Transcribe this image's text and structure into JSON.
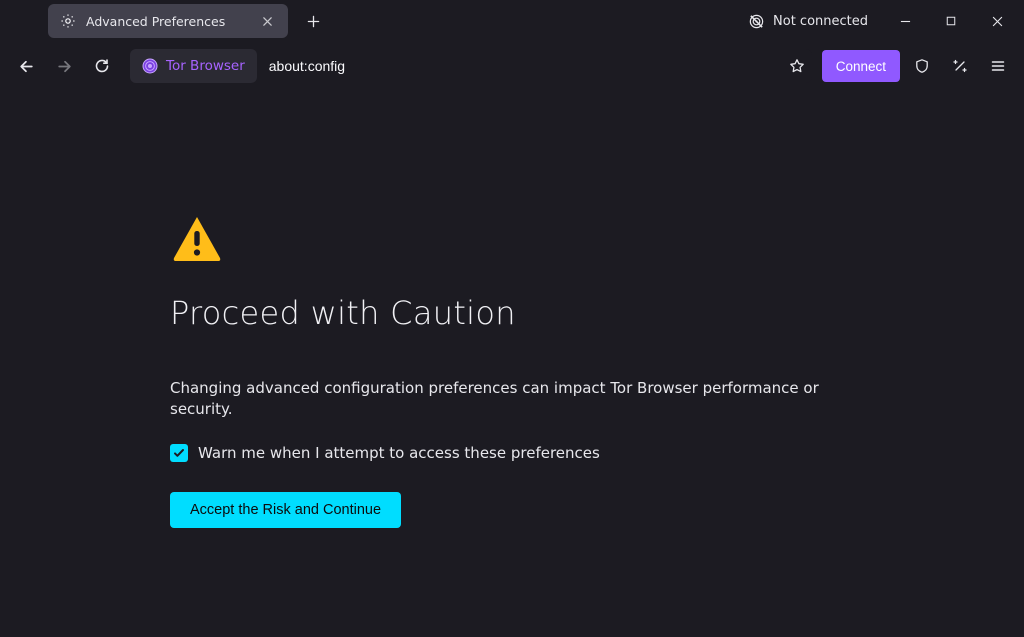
{
  "tab": {
    "title": "Advanced Preferences"
  },
  "connection_status": {
    "label": "Not connected"
  },
  "toolbar": {
    "identity_label": "Tor Browser",
    "url_value": "about:config",
    "connect_label": "Connect"
  },
  "warning": {
    "title": "Proceed with Caution",
    "description": "Changing advanced configuration preferences can impact Tor Browser performance or security.",
    "checkbox_label": "Warn me when I attempt to access these preferences",
    "accept_label": "Accept the Risk and Continue"
  },
  "colors": {
    "accent_purple": "#9059ff",
    "accent_cyan": "#00ddff",
    "warning_yellow": "#ffbd19"
  }
}
